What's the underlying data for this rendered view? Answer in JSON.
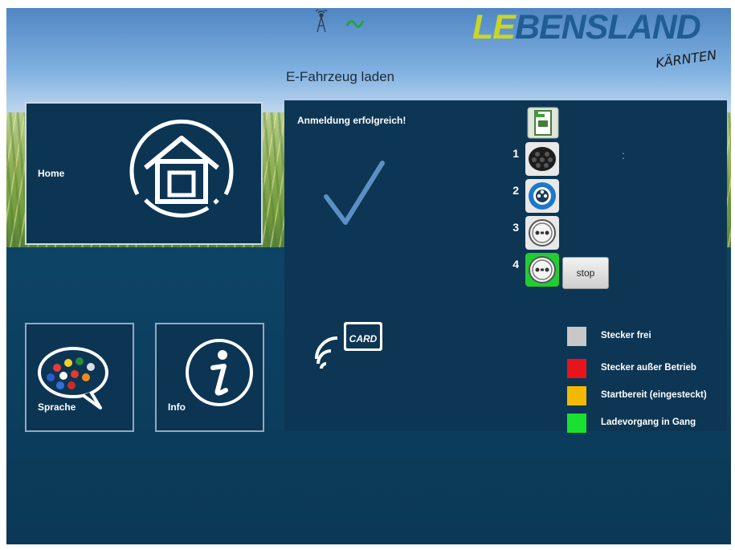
{
  "header": {
    "title": "E-Fahrzeug laden",
    "logo_prefix": "LE",
    "logo_rest": "BENSLAND",
    "logo_sub": "KÄRNTEN"
  },
  "status_icons": [
    "antenna-icon",
    "ac-power-icon"
  ],
  "tiles": {
    "home": {
      "label": "Home",
      "icon": "home-icon"
    },
    "language": {
      "label": "Sprache",
      "icon": "language-flags-icon"
    },
    "info": {
      "label": "Info",
      "icon": "info-icon"
    }
  },
  "panel": {
    "message": "Anmeldung erfolgreich!",
    "check_icon": "checkmark-icon",
    "card_icon": "card-reader-icon",
    "card_text": "CARD",
    "header_icon": "charging-station-icon",
    "colon": ":",
    "plugs": [
      {
        "number": "1",
        "icon": "type2-socket-icon",
        "state_color": "#e8e8e8"
      },
      {
        "number": "2",
        "icon": "cee-socket-icon",
        "state_color": "#e8e8e8"
      },
      {
        "number": "3",
        "icon": "schuko-socket-icon",
        "state_color": "#e8e8e8"
      },
      {
        "number": "4",
        "icon": "schuko-socket-icon",
        "state_color": "#22cc33"
      }
    ],
    "stop_label": "stop"
  },
  "legend": [
    {
      "label": "Stecker frei",
      "color": "#c8c8c8"
    },
    {
      "label": "Stecker außer Betrieb",
      "color": "#e8141b"
    },
    {
      "label": "Startbereit (eingesteckt)",
      "color": "#f5b800"
    },
    {
      "label": "Ladevorgang in Gang",
      "color": "#19e030"
    }
  ]
}
